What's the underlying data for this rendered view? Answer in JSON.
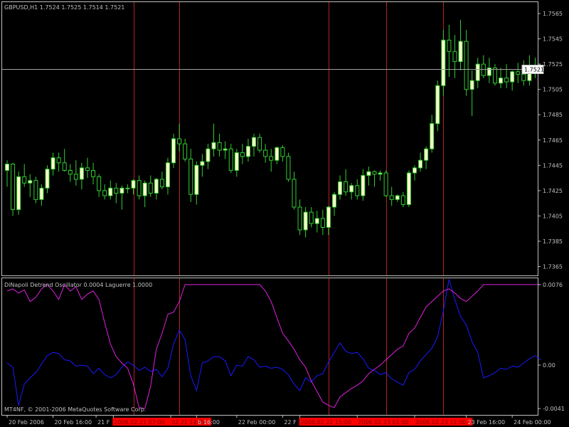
{
  "colors": {
    "background": "#000000",
    "frame": "#c0c0c0",
    "text": "#c0c0c0",
    "candle_bull": "#ffffcc",
    "candle_wick": "#32cd32",
    "candle_bear": "#000000",
    "vline": "#b22222",
    "oscillator_blue": "#1a1aff",
    "oscillator_magenta": "#e020e0",
    "date_highlight": "#ff0000"
  },
  "chart_data": [
    {
      "type": "candlestick",
      "title": "GBPUSD,H1  1.7524 1.7525 1.7514 1.7521",
      "y_ticks": [
        "1.7565",
        "1.7545",
        "1.7525",
        "1.7505",
        "1.7485",
        "1.7465",
        "1.7445",
        "1.7425",
        "1.7405",
        "1.7385",
        "1.7365"
      ],
      "ylim": [
        1.7358,
        1.7574
      ],
      "current_price": "1.7521",
      "ohlc": [
        [
          1.7441,
          1.7449,
          1.7428,
          1.7446
        ],
        [
          1.7446,
          1.7447,
          1.7405,
          1.741
        ],
        [
          1.741,
          1.744,
          1.7406,
          1.7436
        ],
        [
          1.7436,
          1.7446,
          1.7428,
          1.7431
        ],
        [
          1.7431,
          1.7438,
          1.742,
          1.7433
        ],
        [
          1.7433,
          1.7436,
          1.7415,
          1.7418
        ],
        [
          1.7418,
          1.743,
          1.7413,
          1.7427
        ],
        [
          1.7427,
          1.7445,
          1.7423,
          1.7442
        ],
        [
          1.7442,
          1.7455,
          1.7437,
          1.7451
        ],
        [
          1.7451,
          1.7455,
          1.744,
          1.7447
        ],
        [
          1.7447,
          1.7458,
          1.744,
          1.7441
        ],
        [
          1.7441,
          1.7446,
          1.7432,
          1.7438
        ],
        [
          1.7438,
          1.7449,
          1.7429,
          1.7434
        ],
        [
          1.7434,
          1.7447,
          1.7426,
          1.7443
        ],
        [
          1.7443,
          1.7451,
          1.7435,
          1.7441
        ],
        [
          1.7441,
          1.7447,
          1.743,
          1.7436
        ],
        [
          1.7436,
          1.7438,
          1.742,
          1.7425
        ],
        [
          1.7425,
          1.743,
          1.7418,
          1.7421
        ],
        [
          1.7421,
          1.7433,
          1.7418,
          1.7427
        ],
        [
          1.7427,
          1.7431,
          1.7415,
          1.7423
        ],
        [
          1.7423,
          1.7429,
          1.741,
          1.7427
        ],
        [
          1.7427,
          1.743,
          1.7423,
          1.7427
        ],
        [
          1.7427,
          1.7434,
          1.7422,
          1.7433
        ],
        [
          1.7433,
          1.7437,
          1.7418,
          1.7421
        ],
        [
          1.7421,
          1.7433,
          1.7412,
          1.7431
        ],
        [
          1.7431,
          1.7437,
          1.742,
          1.7423
        ],
        [
          1.7423,
          1.7435,
          1.7418,
          1.7434
        ],
        [
          1.7434,
          1.744,
          1.7426,
          1.7428
        ],
        [
          1.7428,
          1.7451,
          1.7422,
          1.7447
        ],
        [
          1.7447,
          1.747,
          1.7443,
          1.7466
        ],
        [
          1.7466,
          1.7478,
          1.7456,
          1.7462
        ],
        [
          1.7462,
          1.7466,
          1.7448,
          1.745
        ],
        [
          1.745,
          1.7458,
          1.7416,
          1.7422
        ],
        [
          1.7422,
          1.7448,
          1.7414,
          1.7445
        ],
        [
          1.7445,
          1.7454,
          1.7436,
          1.7448
        ],
        [
          1.7448,
          1.7462,
          1.7442,
          1.7458
        ],
        [
          1.7458,
          1.7478,
          1.7452,
          1.7463
        ],
        [
          1.7463,
          1.747,
          1.7452,
          1.7457
        ],
        [
          1.7457,
          1.7464,
          1.745,
          1.7458
        ],
        [
          1.7458,
          1.7462,
          1.7439,
          1.7441
        ],
        [
          1.7441,
          1.7458,
          1.7436,
          1.7455
        ],
        [
          1.7455,
          1.7462,
          1.7446,
          1.7452
        ],
        [
          1.7452,
          1.7466,
          1.7448,
          1.746
        ],
        [
          1.746,
          1.747,
          1.7452,
          1.7467
        ],
        [
          1.7467,
          1.747,
          1.7455,
          1.7457
        ],
        [
          1.7457,
          1.7462,
          1.7447,
          1.7452
        ],
        [
          1.7452,
          1.7458,
          1.744,
          1.7449
        ],
        [
          1.7449,
          1.746,
          1.7446,
          1.7459
        ],
        [
          1.7459,
          1.7461,
          1.7448,
          1.7452
        ],
        [
          1.7452,
          1.7455,
          1.7432,
          1.7434
        ],
        [
          1.7434,
          1.744,
          1.741,
          1.7412
        ],
        [
          1.7412,
          1.7418,
          1.739,
          1.7394
        ],
        [
          1.7394,
          1.7412,
          1.7388,
          1.7408
        ],
        [
          1.7408,
          1.7412,
          1.7396,
          1.7399
        ],
        [
          1.7399,
          1.7409,
          1.7392,
          1.7403
        ],
        [
          1.7403,
          1.741,
          1.739,
          1.7396
        ],
        [
          1.7396,
          1.7413,
          1.739,
          1.7412
        ],
        [
          1.7412,
          1.7424,
          1.7405,
          1.7422
        ],
        [
          1.7422,
          1.7437,
          1.7418,
          1.7432
        ],
        [
          1.7432,
          1.7442,
          1.7421,
          1.7424
        ],
        [
          1.7424,
          1.7431,
          1.7418,
          1.7429
        ],
        [
          1.7429,
          1.7434,
          1.7418,
          1.7421
        ],
        [
          1.7421,
          1.7442,
          1.7417,
          1.7437
        ],
        [
          1.7437,
          1.7444,
          1.7429,
          1.744
        ],
        [
          1.744,
          1.7441,
          1.7428,
          1.7438
        ],
        [
          1.7438,
          1.7441,
          1.7433,
          1.7439
        ],
        [
          1.7439,
          1.7441,
          1.742,
          1.7421
        ],
        [
          1.7421,
          1.7428,
          1.7413,
          1.7418
        ],
        [
          1.7418,
          1.7422,
          1.7416,
          1.7421
        ],
        [
          1.7421,
          1.7424,
          1.7412,
          1.7414
        ],
        [
          1.7414,
          1.7441,
          1.7412,
          1.7439
        ],
        [
          1.7439,
          1.7445,
          1.7433,
          1.7443
        ],
        [
          1.7443,
          1.7455,
          1.744,
          1.7449
        ],
        [
          1.7449,
          1.746,
          1.7442,
          1.7458
        ],
        [
          1.7458,
          1.7485,
          1.7455,
          1.7478
        ],
        [
          1.7478,
          1.7512,
          1.7472,
          1.7508
        ],
        [
          1.7508,
          1.7552,
          1.75,
          1.7544
        ],
        [
          1.7544,
          1.7556,
          1.7515,
          1.7535
        ],
        [
          1.7535,
          1.7548,
          1.7514,
          1.7527
        ],
        [
          1.7527,
          1.756,
          1.752,
          1.7543
        ],
        [
          1.7543,
          1.7552,
          1.75,
          1.7505
        ],
        [
          1.7505,
          1.752,
          1.7484,
          1.7512
        ],
        [
          1.7512,
          1.753,
          1.7506,
          1.7525
        ],
        [
          1.7525,
          1.7532,
          1.7514,
          1.7516
        ],
        [
          1.7516,
          1.753,
          1.751,
          1.7522
        ],
        [
          1.7522,
          1.7525,
          1.7508,
          1.751
        ],
        [
          1.751,
          1.7522,
          1.7506,
          1.7514
        ],
        [
          1.7514,
          1.7525,
          1.7506,
          1.7511
        ],
        [
          1.7511,
          1.752,
          1.7504,
          1.7519
        ],
        [
          1.7519,
          1.7526,
          1.751,
          1.7517
        ],
        [
          1.7517,
          1.7528,
          1.7508,
          1.7512
        ],
        [
          1.7512,
          1.7532,
          1.7508,
          1.7524
        ],
        [
          1.7524,
          1.753,
          1.7514,
          1.7521
        ]
      ]
    },
    {
      "type": "line",
      "title": "DiNapoli Detrend Oscillator 0.0004  Laguerre 1.0000",
      "y_ticks": [
        "0.0076",
        "0.00",
        "-0.0041"
      ],
      "ylim": [
        -0.0047,
        0.0082
      ],
      "series": [
        {
          "name": "DiNapoli Detrend Oscillator",
          "color": "#1a1aff",
          "values": [
            0.0002,
            -0.0002,
            -0.0038,
            -0.0018,
            -0.0012,
            -0.0007,
            0.0001,
            0.0009,
            0.0012,
            0.0011,
            0.0005,
            0.0004,
            -0.0001,
            0.0,
            -0.0001,
            -0.0008,
            -0.0003,
            -0.0009,
            -0.0012,
            -0.0009,
            -0.0002,
            0.0003,
            0.0,
            -0.0005,
            -0.0002,
            -0.0006,
            -0.0004,
            -0.0011,
            -0.0003,
            0.002,
            0.0033,
            0.0024,
            -0.001,
            -0.0024,
            0.0002,
            0.0004,
            0.0008,
            0.0008,
            0.0004,
            -0.001,
            0.0,
            -0.0001,
            0.0008,
            0.0005,
            -0.0002,
            -0.0001,
            -0.0003,
            -0.0002,
            -0.0004,
            -0.0009,
            -0.0018,
            -0.0024,
            -0.0012,
            -0.0016,
            -0.001,
            -0.0008,
            0.0003,
            0.0012,
            0.0021,
            0.0013,
            0.0011,
            0.0012,
            0.0006,
            -0.0003,
            -0.0005,
            -0.0009,
            -0.0007,
            -0.0013,
            -0.0016,
            -0.0019,
            -0.0007,
            -0.0004,
            0.0004,
            0.001,
            0.0016,
            0.0027,
            0.0051,
            0.0081,
            0.0062,
            0.0046,
            0.0038,
            0.0022,
            0.0012,
            -0.0012,
            -0.001,
            -0.0007,
            -0.0003,
            -0.0004,
            -0.0001,
            -0.0002,
            0.0002,
            0.0006,
            0.0009,
            0.0005
          ]
        },
        {
          "name": "Laguerre",
          "color": "#e020e0",
          "values": [
            0.007,
            0.0072,
            0.0068,
            0.0071,
            0.006,
            0.0064,
            0.0072,
            0.0076,
            0.007,
            0.0062,
            0.0076,
            0.007,
            0.0074,
            0.0062,
            0.0067,
            0.007,
            0.0062,
            0.004,
            0.002,
            0.0008,
            0.0002,
            -0.0003,
            -0.0018,
            -0.004,
            -0.0041,
            -0.002,
            0.0015,
            0.003,
            0.0048,
            0.005,
            0.006,
            0.0076,
            0.0076,
            0.0076,
            0.0076,
            0.0076,
            0.0076,
            0.0076,
            0.0076,
            0.0076,
            0.0076,
            0.0076,
            0.0076,
            0.0076,
            0.0076,
            0.007,
            0.006,
            0.0045,
            0.003,
            0.0023,
            0.0015,
            0.0005,
            -0.0002,
            -0.0015,
            -0.0025,
            -0.0035,
            -0.0038,
            -0.004,
            -0.003,
            -0.0026,
            -0.0022,
            -0.0019,
            -0.0015,
            -0.0008,
            -0.0004,
            0.0,
            0.0005,
            0.001,
            0.0015,
            0.0018,
            0.003,
            0.0035,
            0.0045,
            0.0055,
            0.006,
            0.0065,
            0.007,
            0.0072,
            0.0068,
            0.0063,
            0.006,
            0.0065,
            0.007,
            0.0076,
            0.0076,
            0.0076,
            0.0076,
            0.0076,
            0.0076,
            0.0076,
            0.0076,
            0.0076,
            0.0076,
            0.0076
          ]
        }
      ]
    }
  ],
  "vlines_bars": [
    22,
    30,
    56,
    66,
    76
  ],
  "x_labels": [
    {
      "text": "20 Feb 2006",
      "bar": 0,
      "highlight": false
    },
    {
      "text": "20 Feb 16:00",
      "bar": 8,
      "highlight": false
    },
    {
      "text": "21 F",
      "bar": 15.5,
      "highlight": false
    },
    {
      "text": "2006.02.21 07:00",
      "bar": 18.5,
      "highlight": true
    },
    {
      "text": "02.21 14:00",
      "bar": 28.5,
      "highlight": true
    },
    {
      "text": "b 16:00",
      "bar": 33,
      "highlight": false
    },
    {
      "text": "22 Feb 00:00",
      "bar": 40,
      "highlight": false
    },
    {
      "text": "22 F",
      "bar": 48,
      "highlight": false
    },
    {
      "text": "2006.02.22 15:00",
      "bar": 51,
      "highlight": true
    },
    {
      "text": "2006.02.23 01:00",
      "bar": 61,
      "highlight": true
    },
    {
      "text": "2006.02.23 11:00",
      "bar": 71,
      "highlight": true
    },
    {
      "text": "23 Feb 16:00",
      "bar": 80,
      "highlight": false
    },
    {
      "text": "24 Feb 00:00",
      "bar": 88,
      "highlight": false
    }
  ],
  "copyright": "MT4NF, © 2001-2006 MetaQuotes Software Corp."
}
